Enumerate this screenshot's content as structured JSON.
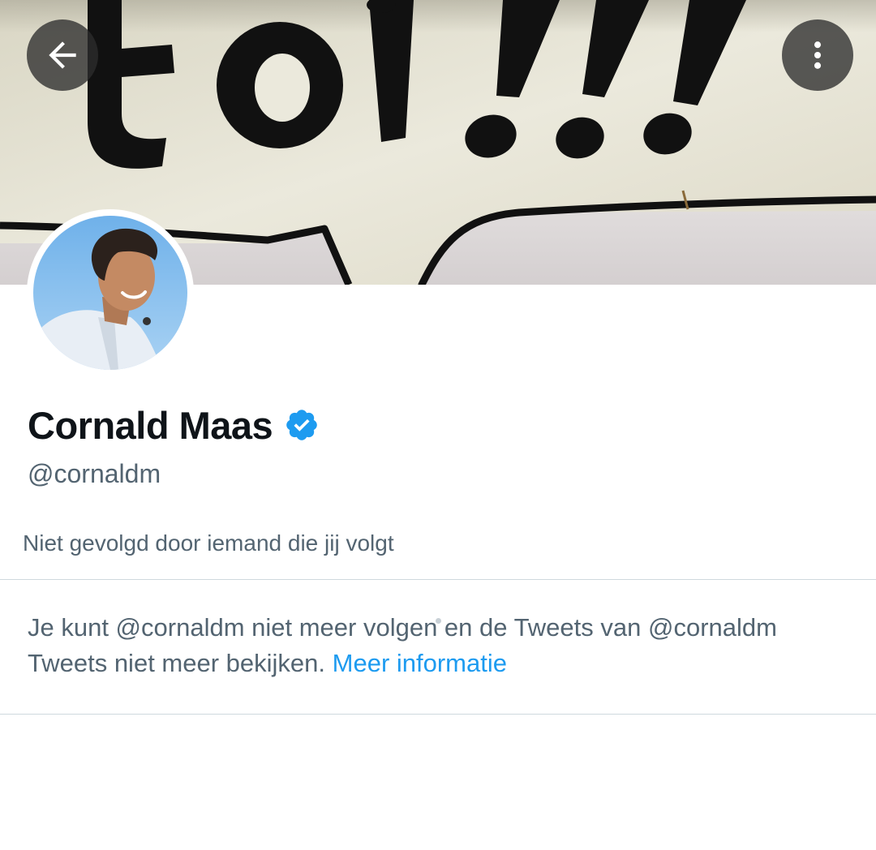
{
  "header": {
    "back_icon": "arrow-left-icon",
    "more_icon": "more-vertical-icon",
    "banner_text": "toi!!!"
  },
  "profile": {
    "display_name": "Cornald Maas",
    "verified_icon": "verified-badge-icon",
    "handle": "@cornaldm",
    "followers_note": "Niet gevolgd door iemand die jij volgt"
  },
  "notice": {
    "line1": "Je kunt @cornaldm niet meer volgen en de Tweets van @cornaldm",
    "line2": "Tweets niet meer bekijken.",
    "link": "Meer informatie"
  },
  "colors": {
    "link": "#1d9bf0",
    "verified": "#1d9bf0",
    "primary_text": "#0f1419",
    "secondary_text": "#536471",
    "divider": "#cfd9de"
  }
}
